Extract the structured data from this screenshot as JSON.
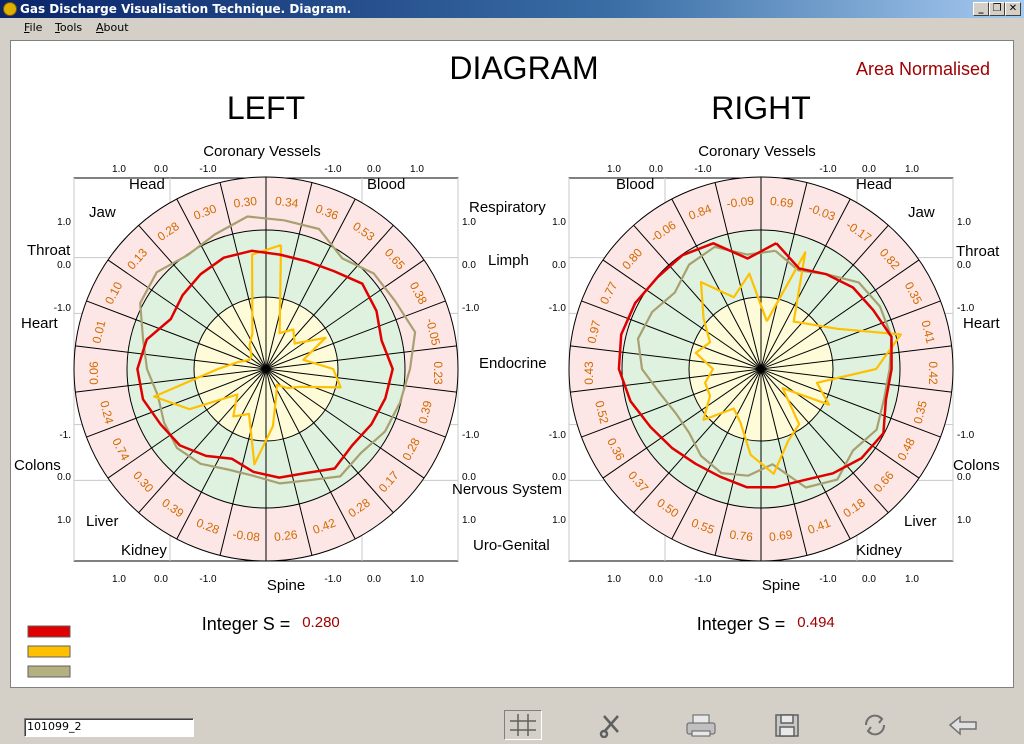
{
  "window": {
    "title": "Gas Discharge Visualisation Technique. Diagram.",
    "controls": [
      "_",
      "❐",
      "✕"
    ]
  },
  "menu": [
    {
      "label": "File",
      "u": "F",
      "rest": "ile"
    },
    {
      "label": "Tools",
      "u": "T",
      "rest": "ools"
    },
    {
      "label": "About",
      "u": "A",
      "rest": "bout"
    }
  ],
  "diagram": {
    "title": "DIAGRAM",
    "normalised_label": "Area Normalised",
    "legend_colors": [
      "#e00000",
      "#ffc000",
      "#b4b080"
    ],
    "line_colors": {
      "red": "#e00000",
      "yellow": "#ffc000",
      "olive": "#a8a070"
    },
    "zone_colors": {
      "outer": "#fde6e6",
      "middle": "#dff2df",
      "inner": "#fdfbd8"
    },
    "panels": [
      {
        "id": "left",
        "heading": "LEFT",
        "integral_label": "Integer S  =",
        "integral_value": "0.280",
        "organ_labels": {
          "top": "Coronary Vessels",
          "bottom": "Spine",
          "tl": [
            "Head",
            "Jaw",
            "Throat",
            "Heart"
          ],
          "tr": [
            "Blood",
            "Respiratory",
            "Limph",
            "Endocrine"
          ],
          "bl": [
            "Colons",
            "Liver",
            "Kidney"
          ],
          "br": [
            "Nervous System",
            "Uro-Genital"
          ]
        },
        "scale": {
          "top": [
            "1.0",
            "0.0",
            "-1.0",
            "-1.0",
            "0.0",
            "1.0"
          ],
          "bottom": [
            "1.0",
            "0.0",
            "-1.0",
            "-1.0",
            "0.0",
            "1.0"
          ],
          "left": [
            "1.0",
            "0.0",
            "-1.0",
            "-1.",
            "0.0",
            "1.0"
          ],
          "right": [
            "1.0",
            "0.0",
            "-1.0",
            "-1.0",
            "0.0",
            "1.0"
          ]
        },
        "sector_values": [
          "0.34",
          "0.36",
          "0.53",
          "0.65",
          "0.38",
          "-0.05",
          "0.23",
          "0.39",
          "0.28",
          "0.17",
          "0.28",
          "0.42",
          "0.26",
          "-0.08",
          "0.28",
          "0.39",
          "0.30",
          "0.74",
          "0.24",
          "0.06",
          "0.01",
          "0.10",
          "0.13",
          "0.28",
          "0.30",
          "0.30"
        ],
        "series": {
          "red": [
            0.6,
            0.6,
            0.62,
            0.67,
            0.65,
            0.62,
            0.66,
            0.64,
            0.62,
            0.6,
            0.63,
            0.58,
            0.57,
            0.54,
            0.5,
            0.55,
            0.6,
            0.62,
            0.66,
            0.67,
            0.64,
            0.56,
            0.58,
            0.6,
            0.62,
            0.62
          ],
          "yellow": [
            0.65,
            0.2,
            0.25,
            0.2,
            0.35,
            0.2,
            0.35,
            0.4,
            0.2,
            0.15,
            0.1,
            0.15,
            0.3,
            0.5,
            0.25,
            0.3,
            0.2,
            0.45,
            0.6,
            0.25,
            0.15,
            0.1,
            0.1,
            0.15,
            0.2,
            0.6
          ],
          "olive": [
            0.78,
            0.78,
            0.7,
            0.75,
            0.76,
            0.8,
            0.75,
            0.72,
            0.7,
            0.66,
            0.68,
            0.62,
            0.6,
            0.56,
            0.56,
            0.6,
            0.62,
            0.6,
            0.58,
            0.62,
            0.66,
            0.74,
            0.76,
            0.72,
            0.75,
            0.8
          ]
        }
      },
      {
        "id": "right",
        "heading": "RIGHT",
        "integral_label": "Integer S  =",
        "integral_value": "0.494",
        "organ_labels": {
          "top": "Coronary Vessels",
          "bottom": "Spine",
          "tl": [
            "Blood"
          ],
          "tr": [
            "Head",
            "Jaw",
            "Throat",
            "Heart"
          ],
          "bl": [
            "Colons"
          ],
          "br": [
            "Liver",
            "Kidney"
          ]
        },
        "scale": {
          "top": [
            "1.0",
            "0.0",
            "-1.0",
            "-1.0",
            "0.0",
            "1.0"
          ],
          "bottom": [
            "1.0",
            "0.0",
            "-1.0",
            "-1.0",
            "0.0",
            "1.0"
          ],
          "left": [
            "1.0",
            "0.0",
            "-1.0",
            "-1.0",
            "0.0",
            "1.0"
          ],
          "right": [
            "1.0",
            "0.0",
            "-1.0",
            "-1.0",
            "0.0",
            "1.0"
          ]
        },
        "sector_values": [
          "0.69",
          "-0.03",
          "-0.17",
          "0.82",
          "0.35",
          "0.41",
          "0.42",
          "0.35",
          "0.48",
          "0.66",
          "0.18",
          "0.41",
          "0.69",
          "0.76",
          "0.55",
          "0.50",
          "0.37",
          "0.36",
          "0.52",
          "0.43",
          "0.97",
          "0.77",
          "0.80",
          "-0.06",
          "0.84",
          "-0.09"
        ],
        "series": {
          "red": [
            0.66,
            0.56,
            0.6,
            0.64,
            0.66,
            0.7,
            0.68,
            0.67,
            0.72,
            0.7,
            0.66,
            0.62,
            0.62,
            0.62,
            0.6,
            0.6,
            0.62,
            0.65,
            0.7,
            0.74,
            0.75,
            0.74,
            0.72,
            0.72,
            0.7,
            0.58
          ],
          "yellow": [
            0.25,
            0.65,
            0.3,
            0.35,
            0.45,
            0.75,
            0.6,
            0.3,
            0.4,
            0.15,
            0.35,
            0.4,
            0.55,
            0.45,
            0.3,
            0.25,
            0.4,
            0.3,
            0.3,
            0.25,
            0.35,
            0.3,
            0.4,
            0.55,
            0.4,
            0.5
          ],
          "olive": [
            0.62,
            0.55,
            0.6,
            0.68,
            0.7,
            0.7,
            0.67,
            0.66,
            0.68,
            0.64,
            0.7,
            0.66,
            0.5,
            0.56,
            0.58,
            0.55,
            0.5,
            0.5,
            0.54,
            0.62,
            0.66,
            0.64,
            0.6,
            0.66,
            0.68,
            0.6
          ]
        }
      }
    ]
  },
  "statusbar": {
    "field_text": "101099_2",
    "tools": [
      "grid-icon",
      "cut-icon",
      "print-icon",
      "save-icon",
      "refresh-icon",
      "back-arrow-icon"
    ]
  }
}
